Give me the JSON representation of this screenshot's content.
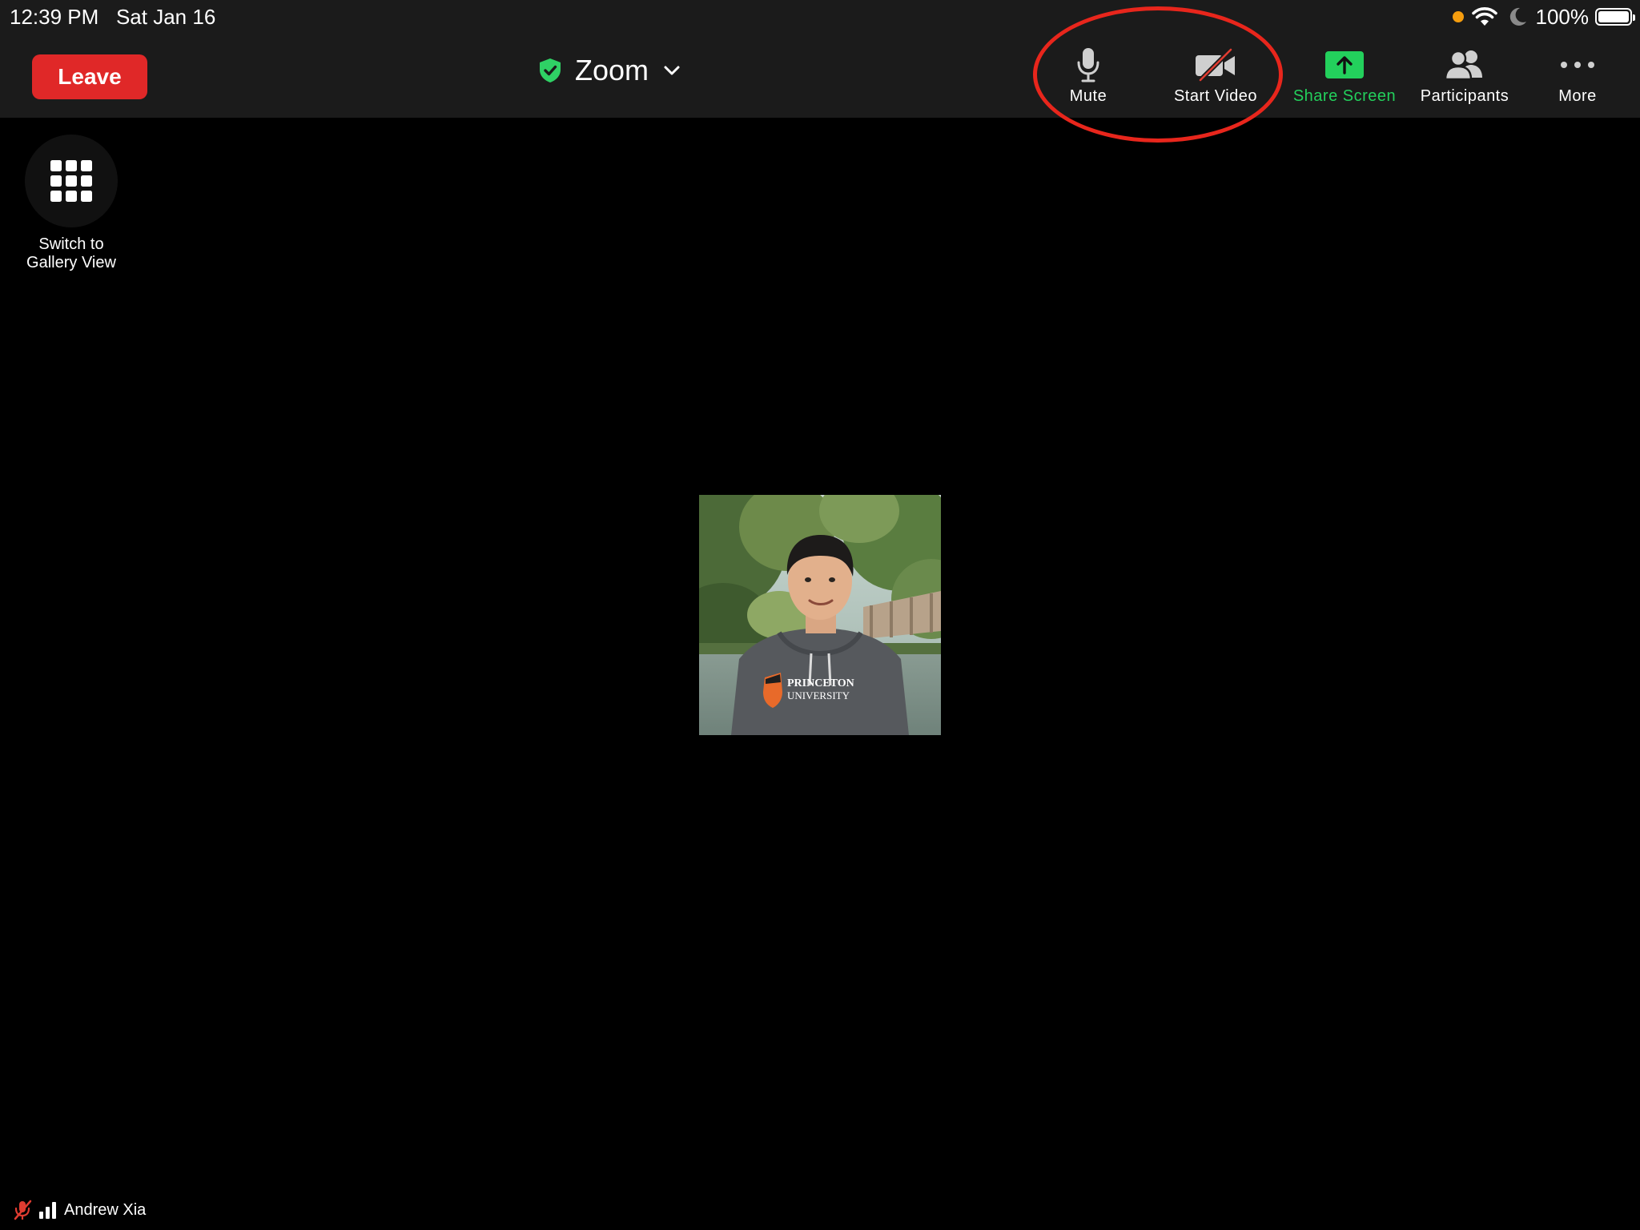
{
  "status_bar": {
    "time": "12:39 PM",
    "date": "Sat Jan 16",
    "battery_percent": "100%",
    "battery_level": 1.0,
    "icons": [
      "orange-dot",
      "wifi-icon",
      "moon-icon",
      "battery-icon"
    ]
  },
  "toolbar": {
    "leave_label": "Leave",
    "meeting_title": "Zoom",
    "mute_label": "Mute",
    "start_video_label": "Start Video",
    "share_screen_label": "Share Screen",
    "participants_label": "Participants",
    "more_label": "More"
  },
  "gallery": {
    "label_line1": "Switch to",
    "label_line2": "Gallery View"
  },
  "participant": {
    "name": "Andrew Xia",
    "hoodie_line1": "PRINCETON",
    "hoodie_line2": "UNIVERSITY"
  },
  "colors": {
    "topbar": "#1b1b1b",
    "leave_red": "#e02828",
    "share_green": "#23d05c",
    "shield_green": "#2fd165",
    "annotation_red": "#e8261c",
    "status_orange": "#f59d0e",
    "muted_red": "#e03c31"
  }
}
